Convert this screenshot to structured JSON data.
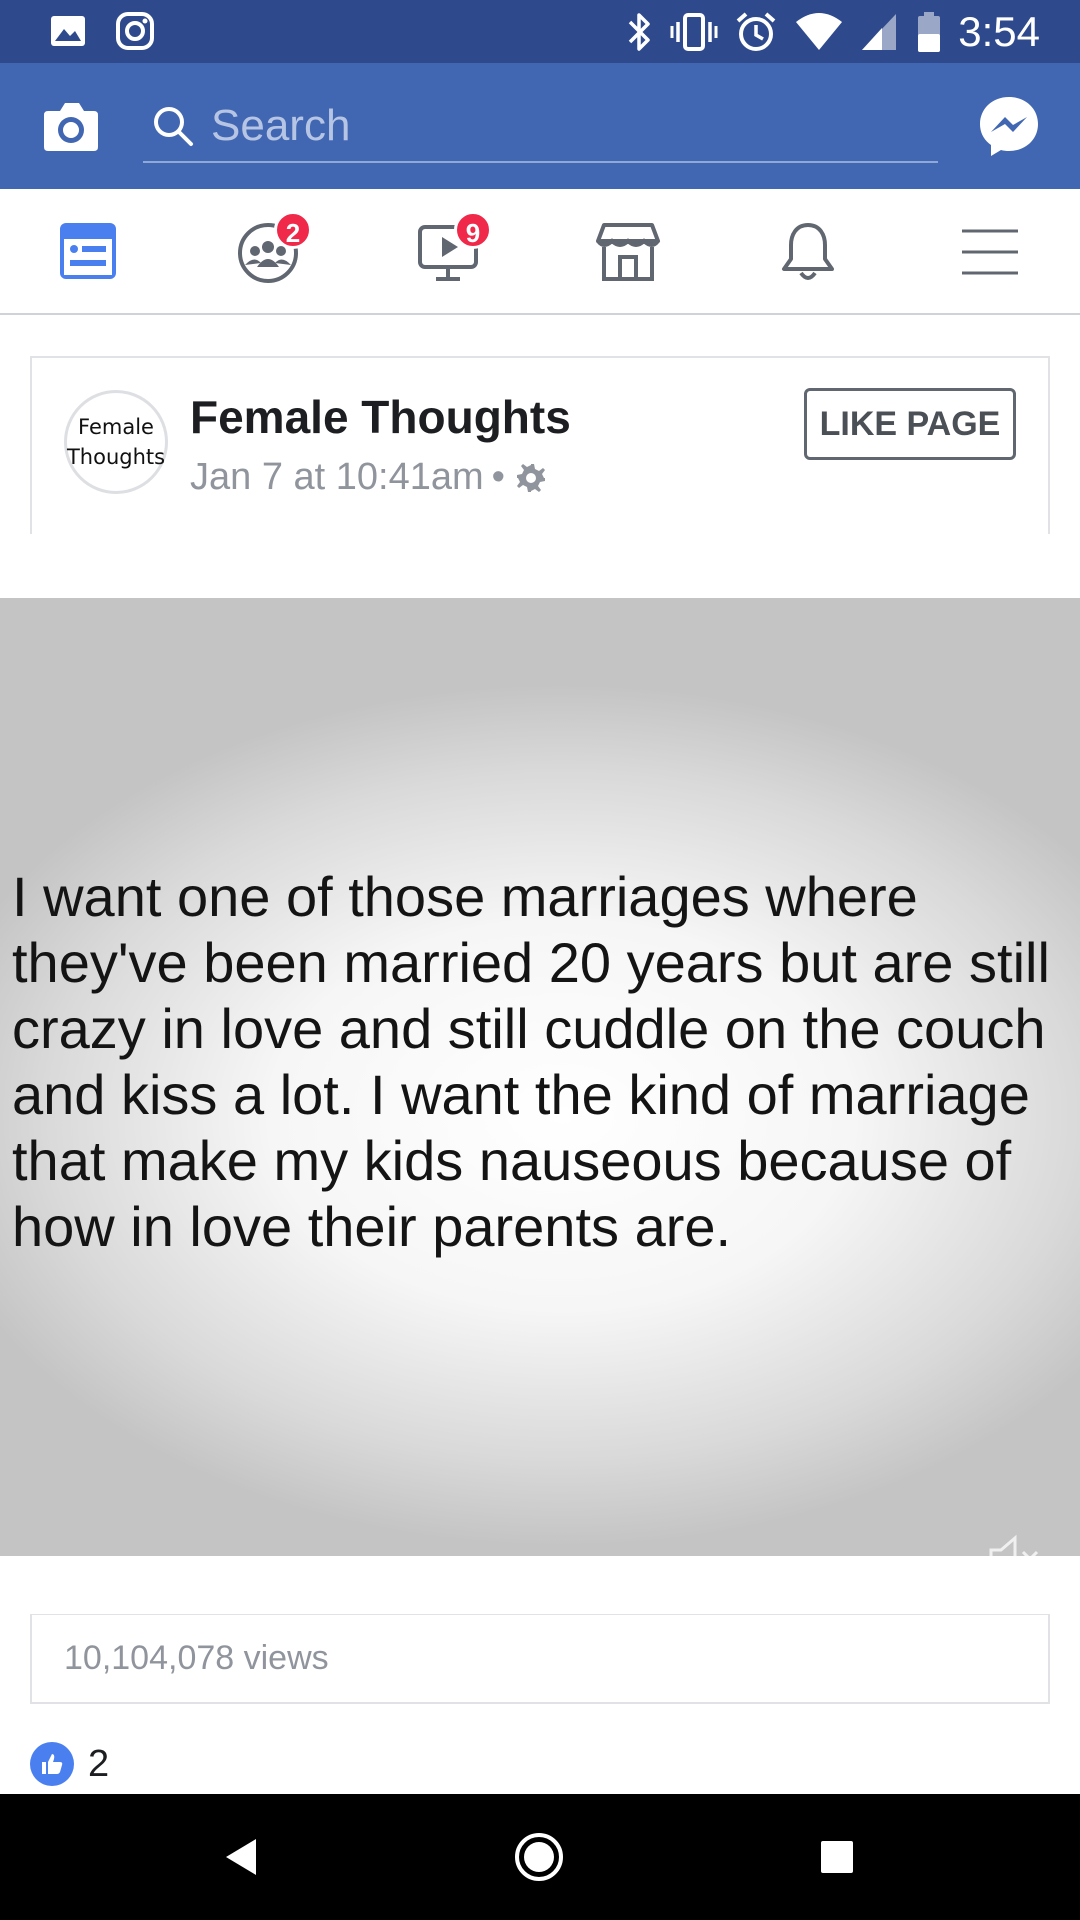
{
  "status_bar": {
    "time": "3:54",
    "icons": [
      "gallery-icon",
      "instagram-icon",
      "bluetooth-icon",
      "vibrate-icon",
      "alarm-icon",
      "wifi-icon",
      "signal-icon",
      "battery-icon"
    ]
  },
  "topbar": {
    "search_placeholder": "Search",
    "colors": {
      "background": "#4267b2",
      "status_bar": "#2f4a8c"
    }
  },
  "navtabs": {
    "items": [
      {
        "name": "news-feed",
        "icon": "news-feed-icon",
        "badge": ""
      },
      {
        "name": "groups",
        "icon": "groups-icon",
        "badge": "2"
      },
      {
        "name": "watch",
        "icon": "watch-icon",
        "badge": "9"
      },
      {
        "name": "marketplace",
        "icon": "marketplace-icon",
        "badge": ""
      },
      {
        "name": "notifications",
        "icon": "bell-icon",
        "badge": ""
      },
      {
        "name": "menu",
        "icon": "hamburger-icon",
        "badge": ""
      }
    ],
    "active_color": "#4a7ff0"
  },
  "post": {
    "avatar_line1": "Female",
    "avatar_line2": "Thoughts",
    "page_name": "Female Thoughts",
    "timestamp": "Jan 7 at 10:41am",
    "separator": "•",
    "like_page_label": "LIKE PAGE"
  },
  "video": {
    "text": "I want one of those marriages where they've been married 20 years but are still crazy in love and still cuddle on the couch and kiss a lot. I want the kind of marriage that make my kids nauseous because of how in love their parents are."
  },
  "stats": {
    "views": "10,104,078 views",
    "reaction_count": "2"
  }
}
